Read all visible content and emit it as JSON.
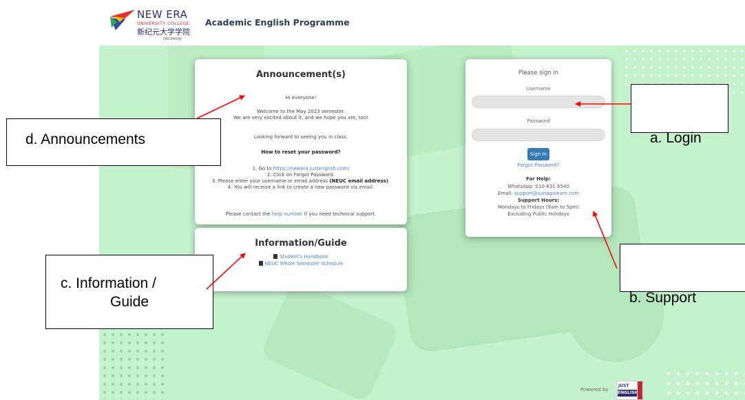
{
  "header": {
    "logo": {
      "brand": "NEW ERA",
      "sub": "UNIVERSITY COLLEGE",
      "cn": "新纪元大学学院",
      "code": "DKU040(B)"
    },
    "title": "Academic English Programme"
  },
  "announcement": {
    "title": "Announcement(s)",
    "greeting": "Hi everyone!",
    "welcome_1": "Welcome to the May 2023 semester.",
    "welcome_2": "We are very excited about it, and we hope you are, too!",
    "looking": "Looking forward to seeing you in class.",
    "reset_heading": "How to reset your password?",
    "step1_prefix": "1. Go to ",
    "step1_link": "https://newera.justenglish.com/",
    "step2": "2. Click on Forgot Password.",
    "step3_prefix": "3. Please enter your username or email address ",
    "step3_bold": "(NEUC email address)",
    "step3_suffix": ".",
    "step4": "4. You will receive a link to create a new password via email.",
    "contact_prefix": "Please contact the ",
    "contact_link": "help number",
    "contact_suffix": " if you need technical support."
  },
  "information": {
    "title": "Information/Guide",
    "documents": [
      "Student's Handbook",
      "NEUC Whole Semester Schedule"
    ]
  },
  "login": {
    "title": "Please sign in",
    "username_label": "Username",
    "username_value": "",
    "password_label": "Password",
    "password_value": "",
    "sign_in_label": "Sign In",
    "forgot_label": "Forgot Password?",
    "help_heading": "For Help:",
    "whatsapp": "WhatsApp: 010-831 6540",
    "email_prefix": "Email: ",
    "email_link": "support@sunagolearn.com",
    "hours_heading": "Support Hours:",
    "hours_1": "Mondays to Fridays (9am to 5pm)",
    "hours_2": "Excluding Public Holidays"
  },
  "footer": {
    "powered_by": "Powered by",
    "logo_top": "JUST",
    "logo_bottom": "ENGLISH"
  },
  "callouts": {
    "announcements": "d. Announcements",
    "information_1": "c. Information /",
    "information_2": "Guide",
    "login": "a. Login",
    "support": "b. Support"
  },
  "colors": {
    "background": "#c4f2cc",
    "arrow": "#ff0000",
    "link": "#4a7ec9",
    "button": "#337ab7"
  },
  "icons": [
    "file-icon"
  ]
}
